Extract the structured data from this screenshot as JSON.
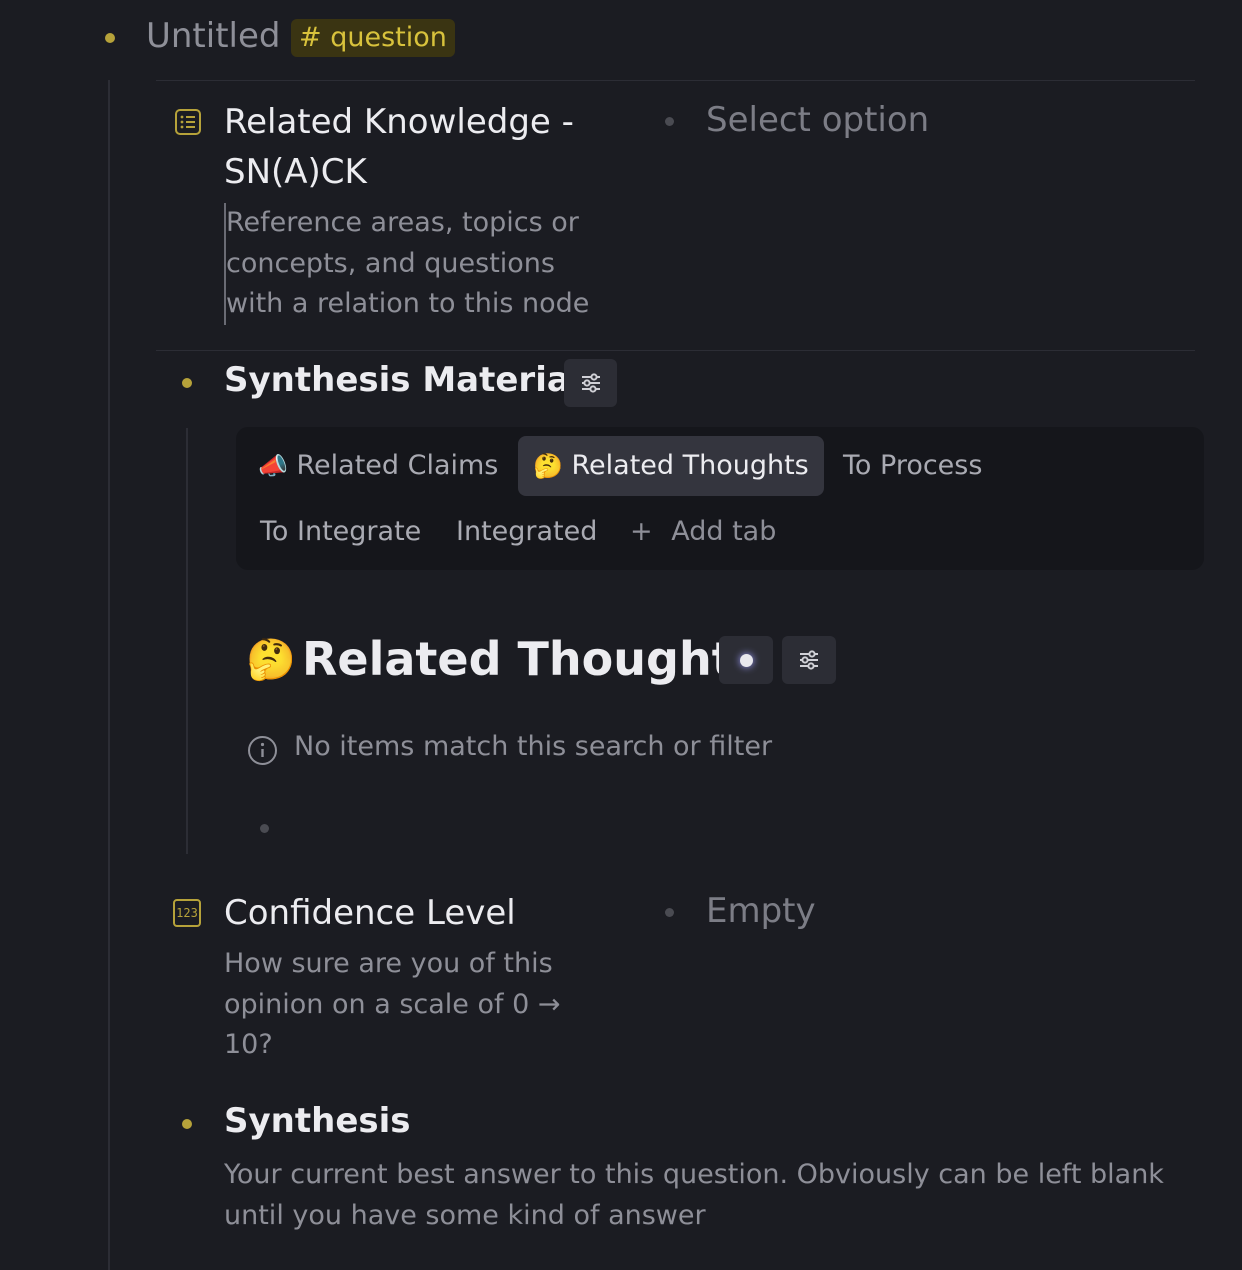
{
  "node": {
    "title": "Untitled",
    "tag": "# question"
  },
  "fields": {
    "related_knowledge": {
      "icon": "list-icon",
      "name_line1": "Related Knowledge -",
      "name_line2": "SN(A)CK",
      "desc_line1": "Reference areas, topics or",
      "desc_line2": "concepts, and questions",
      "desc_line3": "with a relation to this node",
      "value": "Select option"
    },
    "confidence": {
      "icon": "number-icon",
      "icon_text": "123",
      "name": "Confidence Level",
      "desc_line1": "How sure are you of this",
      "desc_line2": "opinion on a scale of 0 →",
      "desc_line3": "10?",
      "value": "Empty"
    }
  },
  "synthesis_material": {
    "title": "Synthesis Material",
    "tabs": [
      {
        "emoji": "📣",
        "label": "Related Claims"
      },
      {
        "emoji": "🤔",
        "label": "Related Thoughts"
      },
      {
        "label": "To Process"
      },
      {
        "label": "To Integrate"
      },
      {
        "label": "Integrated"
      }
    ],
    "add_tab": "Add tab",
    "view": {
      "emoji": "🤔",
      "title": "Related Thoughts",
      "empty_message": "No items match this search or filter"
    }
  },
  "synthesis": {
    "title": "Synthesis",
    "desc_line1": "Your current best answer to this question. Obviously can be left blank",
    "desc_line2": "until you have some kind of answer"
  },
  "colors": {
    "background": "#1b1c22",
    "accent_gold": "#b6a23a",
    "tag_bg": "#3a3412",
    "tag_text": "#d8c23c"
  }
}
